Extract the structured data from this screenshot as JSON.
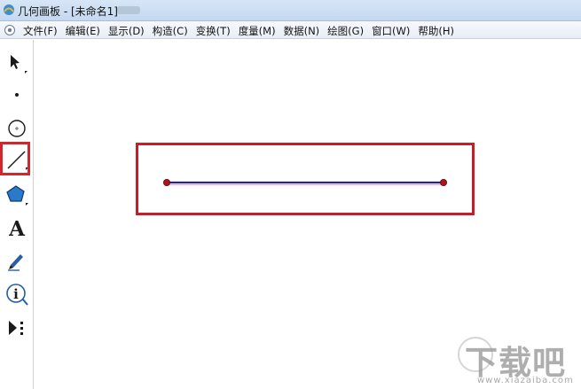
{
  "window": {
    "title": "几何画板 - [未命名1]"
  },
  "menubar": {
    "items": [
      {
        "label": "文件(F)"
      },
      {
        "label": "编辑(E)"
      },
      {
        "label": "显示(D)"
      },
      {
        "label": "构造(C)"
      },
      {
        "label": "变换(T)"
      },
      {
        "label": "度量(M)"
      },
      {
        "label": "数据(N)"
      },
      {
        "label": "绘图(G)"
      },
      {
        "label": "窗口(W)"
      },
      {
        "label": "帮助(H)"
      }
    ]
  },
  "toolbox": {
    "tools": [
      {
        "icon": "arrow-select-icon"
      },
      {
        "icon": "point-icon"
      },
      {
        "icon": "compass-circle-icon"
      },
      {
        "icon": "straightedge-segment-icon",
        "selected": true
      },
      {
        "icon": "polygon-icon"
      },
      {
        "icon": "text-icon",
        "glyph": "A"
      },
      {
        "icon": "marker-pen-icon"
      },
      {
        "icon": "information-icon",
        "glyph": "i"
      },
      {
        "icon": "custom-tool-icon"
      }
    ]
  },
  "colors": {
    "highlight": "#c41f26",
    "segment": "#2a1f8c",
    "endpoint": "#b01515"
  },
  "watermark": {
    "text": "下载吧",
    "url": "www.xiazaiba.com"
  }
}
